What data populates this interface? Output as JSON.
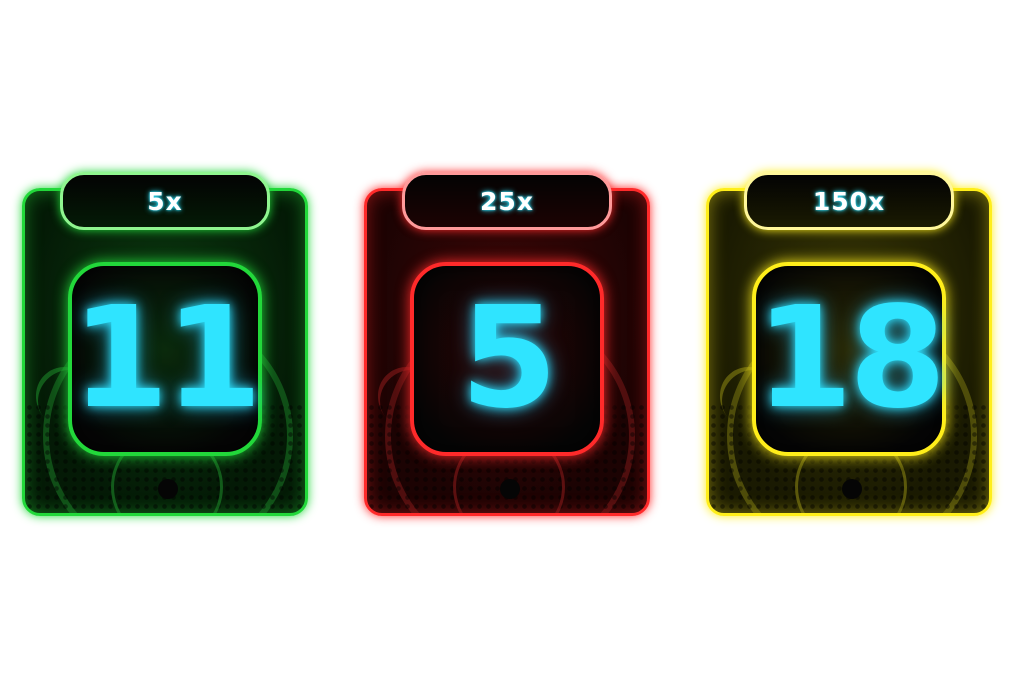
{
  "digit_color": "#2fe4ff",
  "cards": [
    {
      "multiplier": "5x",
      "number": "11",
      "accent": "#22d83a",
      "bg": "#041a06",
      "inner": "#0b3a10",
      "glow": "rgba(40,220,60,0.45)",
      "arc": "#1f8f2c",
      "tile_inner": "#0a2a0c",
      "tag_border": "#8ff58f"
    },
    {
      "multiplier": "25x",
      "number": "5",
      "accent": "#ff2a2a",
      "bg": "#1c0303",
      "inner": "#3e0707",
      "glow": "rgba(255,40,40,0.45)",
      "arc": "#8f1c1c",
      "tile_inner": "#2e0404",
      "tag_border": "#ff9a9a"
    },
    {
      "multiplier": "150x",
      "number": "18",
      "accent": "#ffee1a",
      "bg": "#1a1a02",
      "inner": "#3a3805",
      "glow": "rgba(255,238,30,0.45)",
      "arc": "#8f8a14",
      "tile_inner": "#2a2804",
      "tag_border": "#fff79a"
    }
  ]
}
